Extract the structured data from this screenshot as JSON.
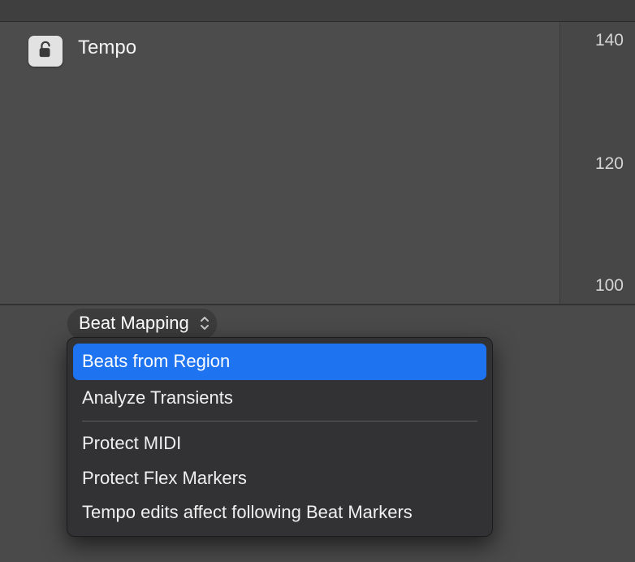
{
  "header": {
    "track_name": "Tempo"
  },
  "scale": {
    "v140": "140",
    "v120": "120",
    "v100": "100"
  },
  "popup": {
    "label": "Beat Mapping"
  },
  "menu": {
    "items": {
      "beats_from_region": "Beats from Region",
      "analyze_transients": "Analyze Transients",
      "protect_midi": "Protect MIDI",
      "protect_flex_markers": "Protect Flex Markers",
      "tempo_edits_affect": "Tempo edits affect following Beat Markers"
    },
    "selected": "beats_from_region"
  }
}
